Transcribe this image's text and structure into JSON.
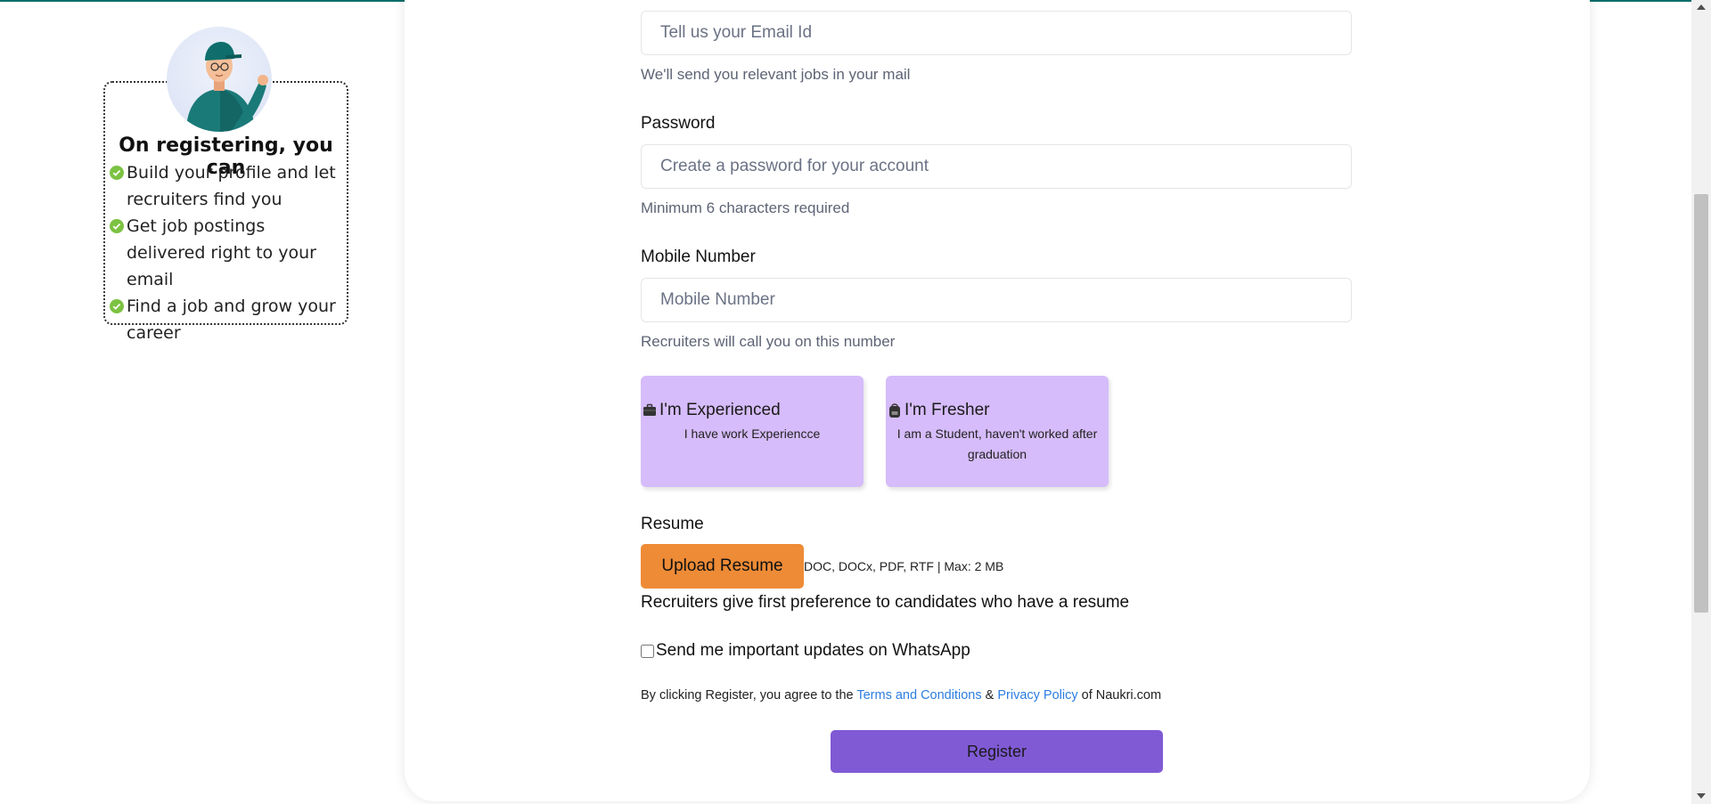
{
  "benefits": {
    "heading": "On registering, you can",
    "items": [
      {
        "text": "Build your profile and let recruiters find you"
      },
      {
        "text": "Get job postings delivered right to your email"
      },
      {
        "text": "Find a job and grow your career"
      }
    ],
    "check_color": "#7cc242"
  },
  "form": {
    "email": {
      "placeholder": "Tell us your Email Id",
      "hint": "We'll send you relevant jobs in your mail"
    },
    "password": {
      "label": "Password",
      "placeholder": "Create a password for your account",
      "hint": "Minimum 6 characters required"
    },
    "mobile": {
      "label": "Mobile Number",
      "placeholder": "Mobile Number",
      "hint": "Recruiters will call you on this number"
    },
    "work_status": {
      "experienced": {
        "title": "I'm Experienced",
        "desc": "I have work Experiencce",
        "icon": "briefcase-icon"
      },
      "fresher": {
        "title": "I'm Fresher",
        "desc": "I am a Student, haven't worked after graduation",
        "icon": "backpack-icon"
      }
    },
    "resume": {
      "label": "Resume",
      "button": "Upload Resume",
      "formats": "DOC, DOCx, PDF, RTF | Max: 2 MB",
      "preference_note": "Recruiters give first preference to candidates who have a resume"
    },
    "whatsapp_optin": {
      "label": "Send me important updates on WhatsApp",
      "checked": false
    },
    "terms": {
      "prefix": "By clicking Register, you agree to the",
      "terms_link": "Terms and Conditions",
      "amp": "&",
      "privacy_link": "Privacy Policy",
      "suffix": "of Naukri.com"
    },
    "register_button": "Register"
  },
  "colors": {
    "accent_purple": "#805ad5",
    "choice_bg": "#d6bcfa",
    "upload_orange": "#ee8b36",
    "link_blue": "#2b7de0",
    "top_bar": "#0b6e6a"
  }
}
